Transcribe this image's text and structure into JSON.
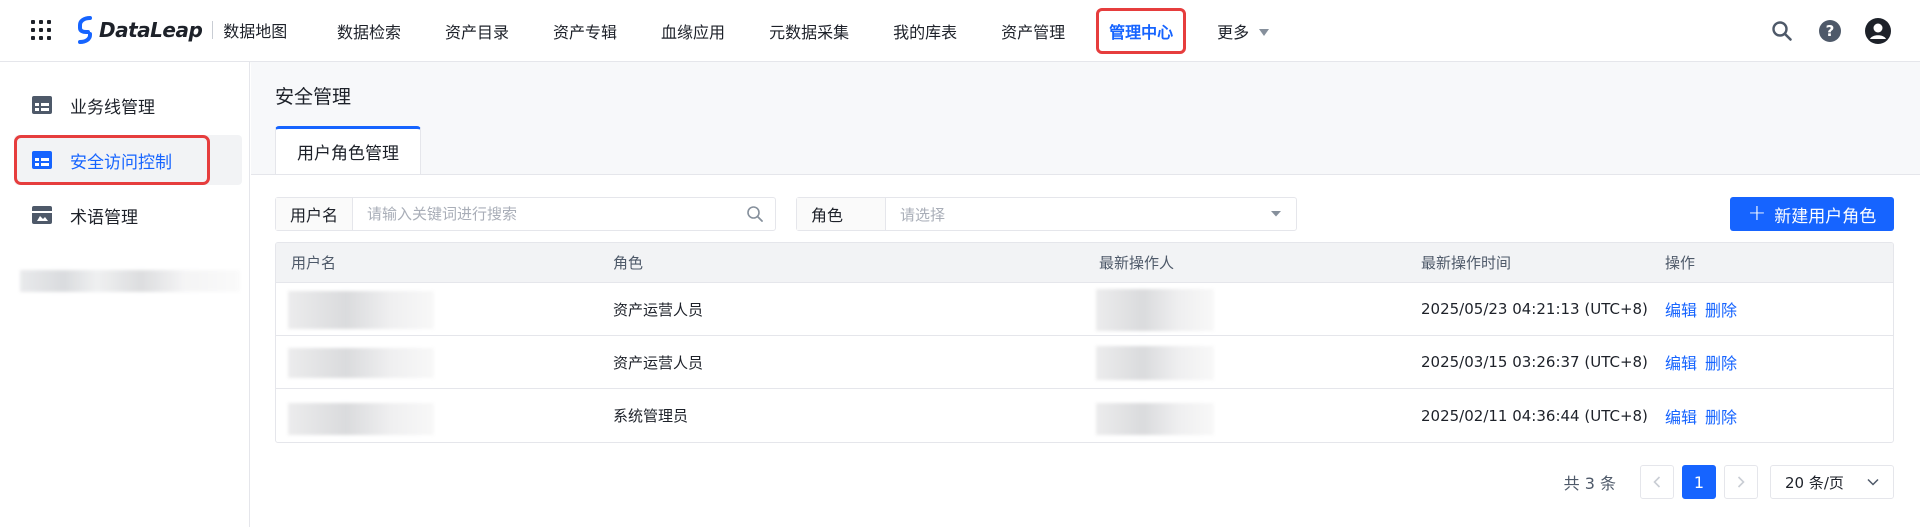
{
  "header": {
    "logo_text": "DataLeap",
    "logo_sub": "数据地图",
    "nav": [
      {
        "label": "数据检索"
      },
      {
        "label": "资产目录"
      },
      {
        "label": "资产专辑"
      },
      {
        "label": "血缘应用"
      },
      {
        "label": "元数据采集"
      },
      {
        "label": "我的库表"
      },
      {
        "label": "资产管理"
      },
      {
        "label": "管理中心",
        "active": true
      },
      {
        "label": "更多"
      }
    ],
    "icons": [
      "search-icon",
      "help-icon",
      "user-avatar-icon"
    ]
  },
  "sidebar": {
    "items": [
      {
        "label": "业务线管理",
        "icon": "table-icon"
      },
      {
        "label": "安全访问控制",
        "icon": "table-icon",
        "active": true
      },
      {
        "label": "术语管理",
        "icon": "glossary-icon"
      }
    ]
  },
  "main": {
    "title": "安全管理",
    "tabs": [
      {
        "label": "用户角色管理",
        "active": true
      }
    ],
    "filters": {
      "username_label": "用户名",
      "username_placeholder": "请输入关键词进行搜索",
      "role_label": "角色",
      "role_placeholder": "请选择"
    },
    "new_button_label": "新建用户角色",
    "table": {
      "columns": [
        "用户名",
        "角色",
        "最新操作人",
        "最新操作时间",
        "操作"
      ],
      "rows": [
        {
          "role": "资产运营人员",
          "time": "2025/05/23 04:21:13 (UTC+8)"
        },
        {
          "role": "资产运营人员",
          "time": "2025/03/15 03:26:37 (UTC+8)"
        },
        {
          "role": "系统管理员",
          "time": "2025/02/11 04:36:44 (UTC+8)"
        }
      ],
      "actions": {
        "edit": "编辑",
        "delete": "删除"
      }
    },
    "pagination": {
      "total_text": "共 3 条",
      "current_page": "1",
      "page_size": "20 条/页"
    }
  },
  "colors": {
    "accent": "#1664ff",
    "highlight": "#e63d3d"
  }
}
